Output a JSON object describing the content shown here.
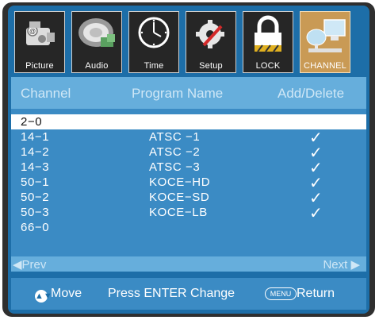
{
  "tabs": [
    {
      "label": "Picture",
      "icon": "camera-icon",
      "active": false
    },
    {
      "label": "Audio",
      "icon": "speaker-icon",
      "active": false
    },
    {
      "label": "Time",
      "icon": "clock-icon",
      "active": false
    },
    {
      "label": "Setup",
      "icon": "gear-tools-icon",
      "active": false
    },
    {
      "label": "LOCK",
      "icon": "lock-icon",
      "active": false
    },
    {
      "label": "CHANNEL",
      "icon": "satellite-dish-icon",
      "active": true
    }
  ],
  "table": {
    "headers": {
      "channel": "Channel",
      "program": "Program Name",
      "add_delete": "Add/Delete"
    },
    "rows": [
      {
        "channel": "2−0",
        "program": "",
        "added": false,
        "selected": true
      },
      {
        "channel": "14−1",
        "program": "ATSC −1",
        "added": true
      },
      {
        "channel": "14−2",
        "program": "ATSC −2",
        "added": true
      },
      {
        "channel": "14−3",
        "program": "ATSC −3",
        "added": true
      },
      {
        "channel": "50−1",
        "program": "KOCE−HD",
        "added": true
      },
      {
        "channel": "50−2",
        "program": "KOCE−SD",
        "added": true
      },
      {
        "channel": "50−3",
        "program": "KOCE−LB",
        "added": true
      },
      {
        "channel": "66−0",
        "program": "",
        "added": false
      }
    ],
    "checkmark": "✓"
  },
  "pager": {
    "prev": "◀Prev",
    "next": "Next ▶"
  },
  "footer": {
    "move_label": "Move",
    "enter_label": "Press ENTER Change",
    "menu_key": "MENU",
    "return_label": "Return"
  },
  "colors": {
    "bezel": "#2f2f2f",
    "background": "#1d6ea8",
    "header": "#66aedc",
    "panel": "#3b8bc4",
    "active_tab": "#c99a55"
  }
}
